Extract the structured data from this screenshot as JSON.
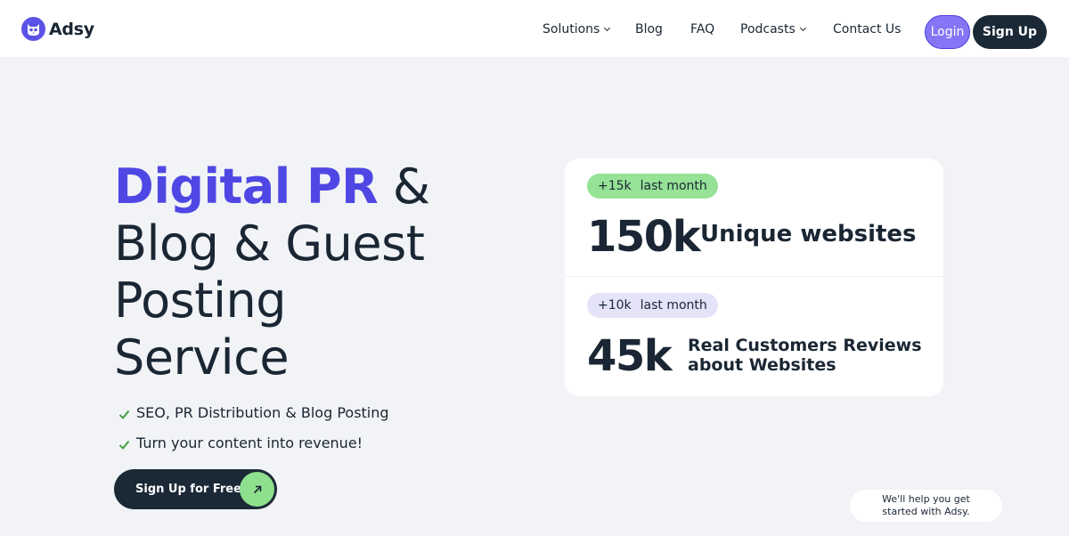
{
  "header": {
    "logo_text": "Adsy",
    "nav": [
      {
        "label": "Solutions",
        "dropdown": true
      },
      {
        "label": "Blog",
        "dropdown": false
      },
      {
        "label": "FAQ",
        "dropdown": false
      },
      {
        "label": "Podcasts",
        "dropdown": true
      },
      {
        "label": "Contact Us",
        "dropdown": false
      }
    ],
    "login_label": "Login",
    "signup_label": "Sign Up"
  },
  "hero": {
    "title_highlight": "Digital PR",
    "title_line1_rest": " &",
    "title_line2": "Blog & Guest",
    "title_line3": "Posting",
    "title_line4": "Service",
    "checks": [
      "SEO, PR Distribution & Blog Posting",
      "Turn your content into revenue!"
    ],
    "cta_label": "Sign Up for Free"
  },
  "stats": [
    {
      "badge_value": "+15k",
      "badge_text": "last month",
      "number": "150k",
      "label": "Unique websites"
    },
    {
      "badge_value": "+10k",
      "badge_text": "last month",
      "number": "45k",
      "label_line1": "Real Customers Reviews",
      "label_line2": "about Websites"
    }
  ],
  "chat": {
    "line1": "We'll help you get",
    "line2": "started with Adsy."
  },
  "colors": {
    "accent": "#4f47e4",
    "login_bg": "#8576f5",
    "dark": "#1b2937",
    "green": "#96e296",
    "lavender": "#e4e3f7",
    "page_bg": "#f1f3f6"
  }
}
